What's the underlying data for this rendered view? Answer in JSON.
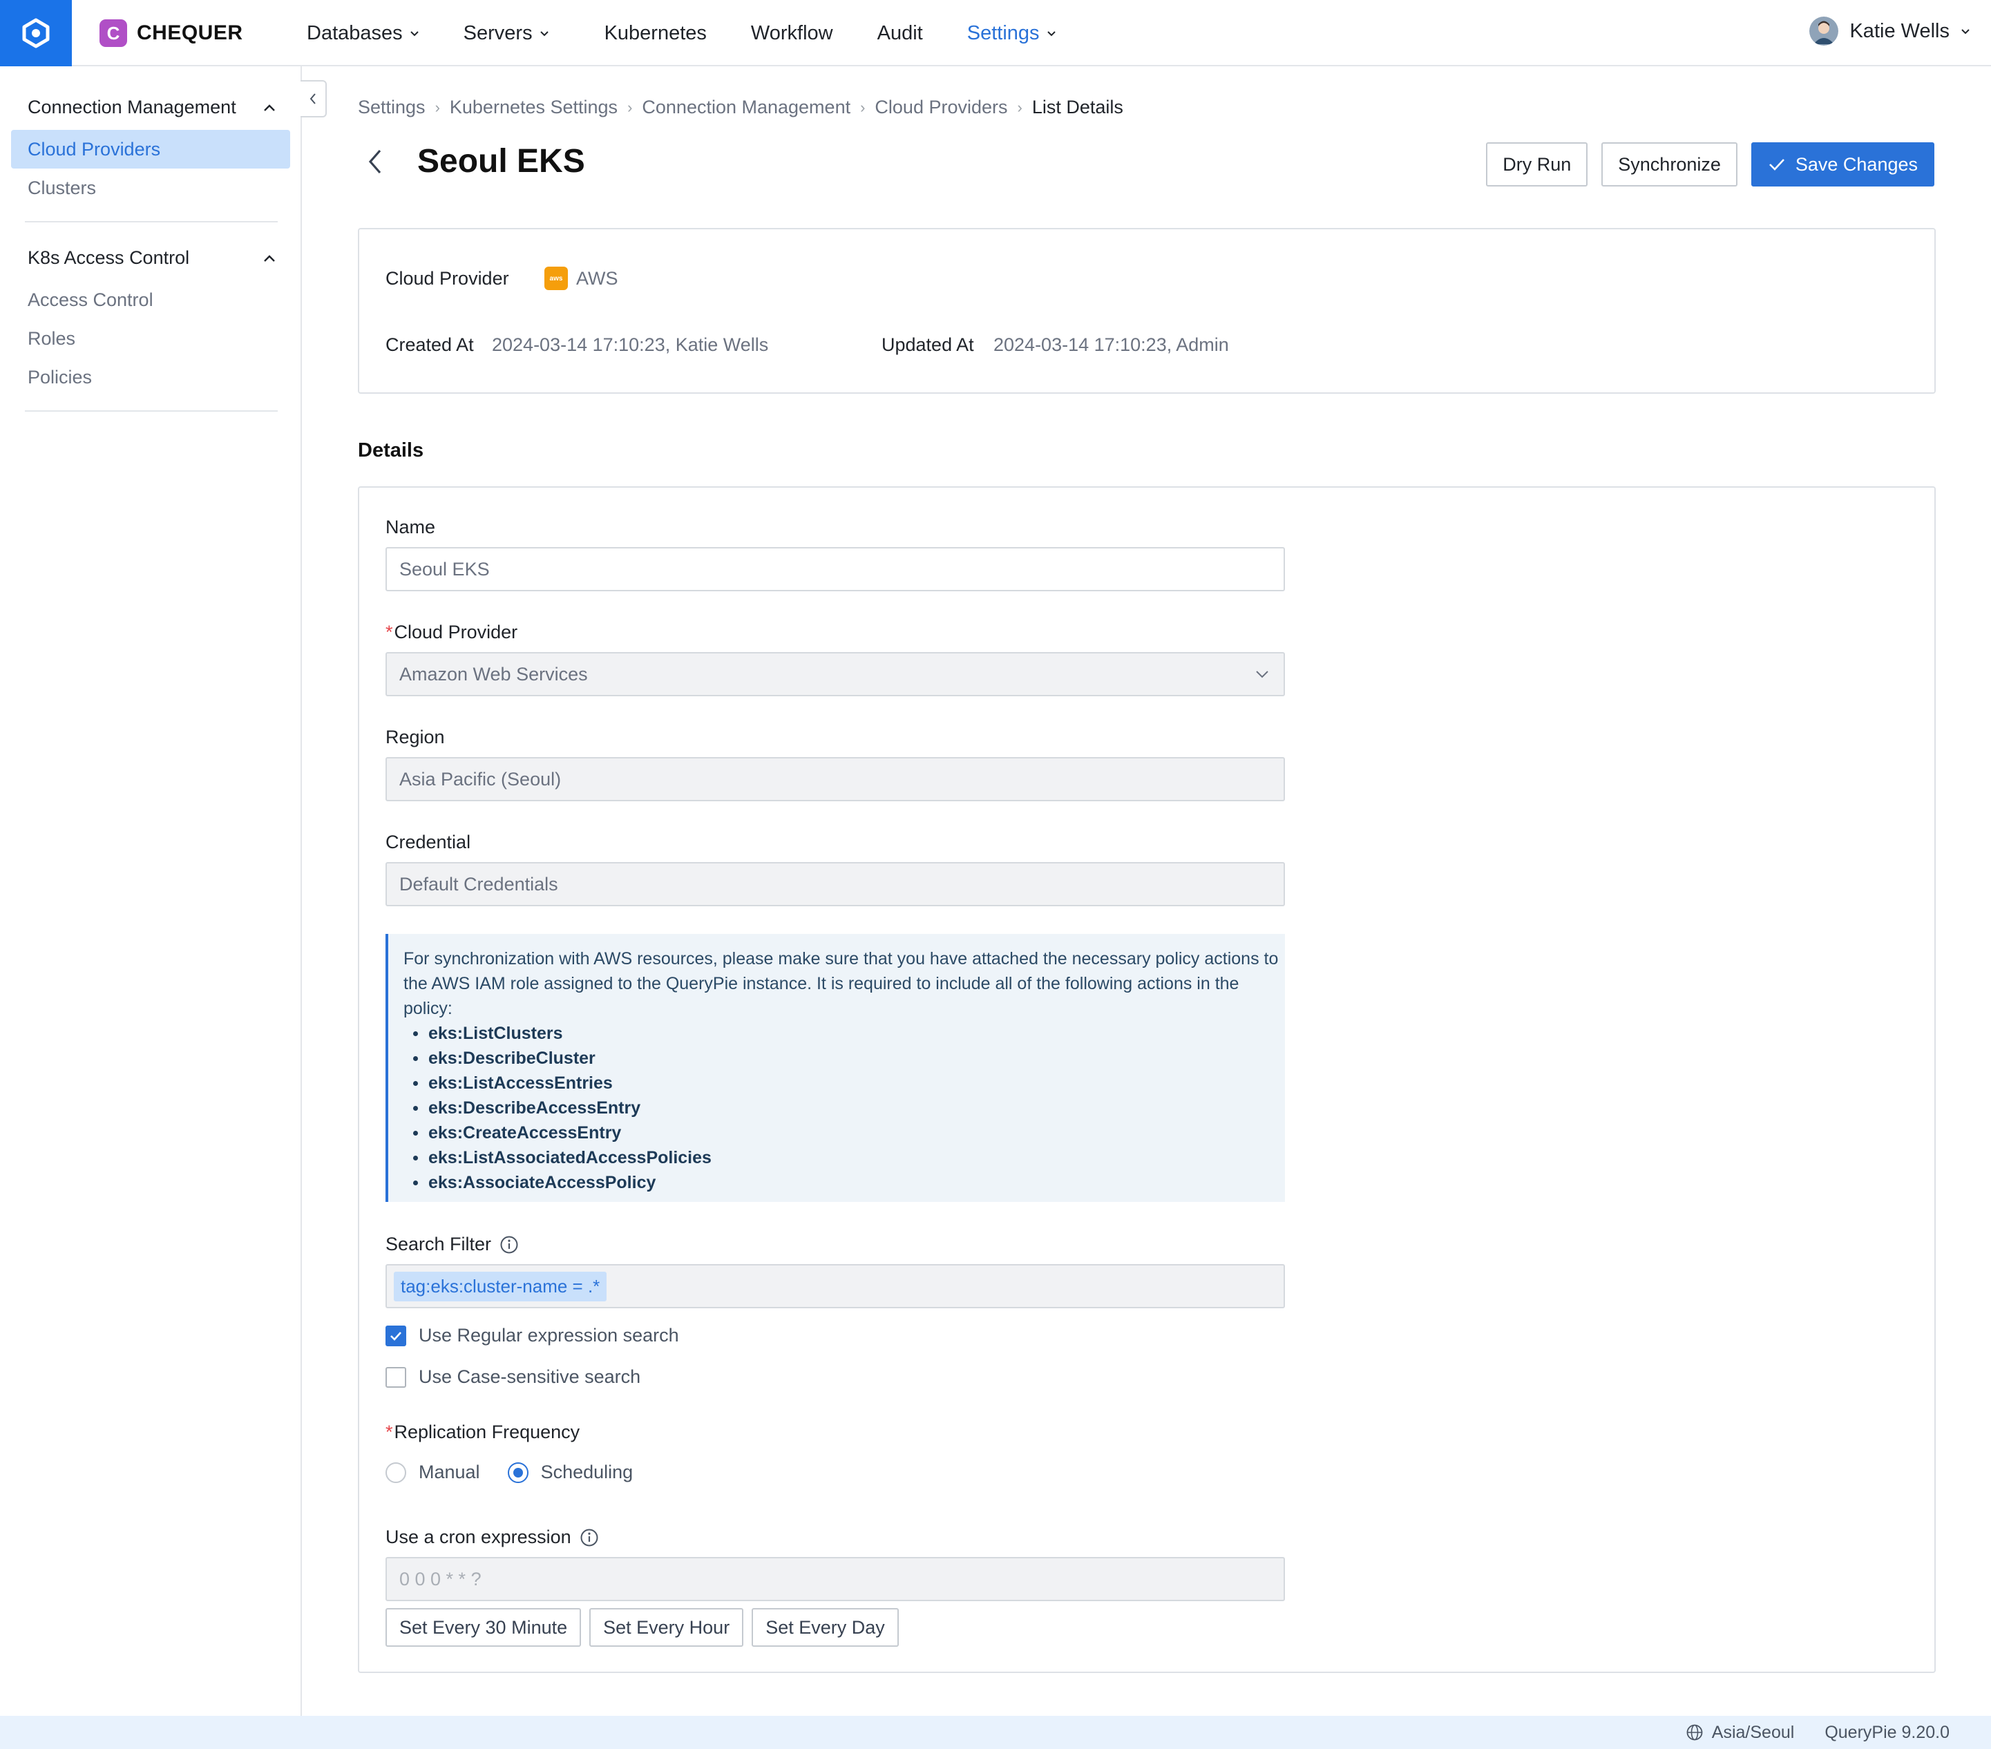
{
  "brand": {
    "name": "CHEQUER",
    "badge_letter": "C",
    "badge_color": "#b04fc6",
    "accent": "#1a73e8"
  },
  "nav": {
    "items": [
      {
        "label": "Databases",
        "has_dropdown": true
      },
      {
        "label": "Servers",
        "has_dropdown": true
      },
      {
        "label": "Kubernetes",
        "has_dropdown": false
      },
      {
        "label": "Workflow",
        "has_dropdown": false
      },
      {
        "label": "Audit",
        "has_dropdown": false
      },
      {
        "label": "Settings",
        "has_dropdown": true,
        "active": true
      }
    ],
    "user_name": "Katie Wells"
  },
  "sidebar": {
    "sections": [
      {
        "title": "Connection Management",
        "items": [
          "Cloud Providers",
          "Clusters"
        ],
        "active_item": "Cloud Providers"
      },
      {
        "title": "K8s Access Control",
        "items": [
          "Access Control",
          "Roles",
          "Policies"
        ]
      }
    ]
  },
  "breadcrumb": [
    "Settings",
    "Kubernetes Settings",
    "Connection Management",
    "Cloud Providers",
    "List Details"
  ],
  "page": {
    "title": "Seoul EKS"
  },
  "actions": {
    "dry_run": "Dry Run",
    "synchronize": "Synchronize",
    "save": "Save Changes"
  },
  "summary": {
    "cloud_provider_label": "Cloud Provider",
    "cloud_provider_value": "AWS",
    "aws_icon_text": "aws",
    "created_label": "Created At",
    "created_value": "2024-03-14 17:10:23, Katie Wells",
    "updated_label": "Updated At",
    "updated_value": "2024-03-14 17:10:23, Admin"
  },
  "details": {
    "title": "Details",
    "name_label": "Name",
    "name_value": "Seoul EKS",
    "provider_label": "Cloud Provider",
    "provider_value": "Amazon Web Services",
    "region_label": "Region",
    "region_value": "Asia Pacific (Seoul)",
    "credential_label": "Credential",
    "credential_value": "Default Credentials",
    "notice_text": "For synchronization with AWS resources, please make sure that you have attached the necessary policy actions to the AWS IAM role assigned to the QueryPie instance. It is required to include all of the following actions in the policy:",
    "notice_actions": [
      "eks:ListClusters",
      "eks:DescribeCluster",
      "eks:ListAccessEntries",
      "eks:DescribeAccessEntry",
      "eks:CreateAccessEntry",
      "eks:ListAssociatedAccessPolicies",
      "eks:AssociateAccessPolicy"
    ],
    "search_filter_label": "Search Filter",
    "search_filter_tag": "tag:eks:cluster-name = .*",
    "regex_label": "Use Regular expression search",
    "regex_checked": true,
    "case_label": "Use Case-sensitive search",
    "case_checked": false,
    "replication_label": "Replication Frequency",
    "replication_options": [
      "Manual",
      "Scheduling"
    ],
    "replication_selected": "Scheduling",
    "cron_label": "Use a cron expression",
    "cron_placeholder": "0 0 0 * * ?",
    "presets": [
      "Set Every 30 Minute",
      "Set Every Hour",
      "Set Every Day"
    ]
  },
  "footer": {
    "timezone": "Asia/Seoul",
    "version": "QueryPie 9.20.0"
  }
}
